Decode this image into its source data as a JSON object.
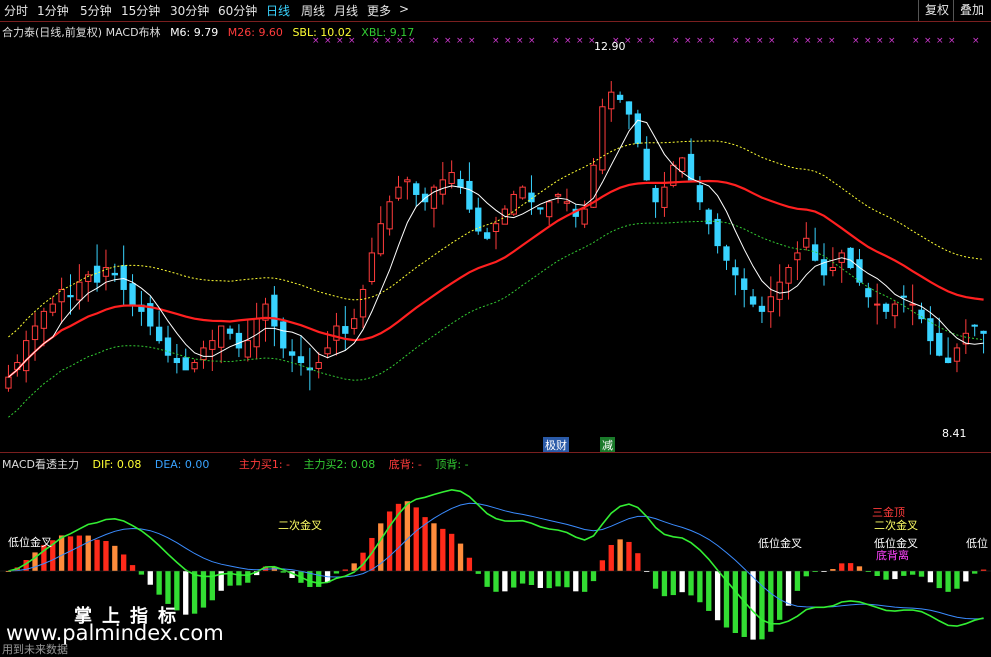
{
  "toolbar": {
    "periods": [
      "分时",
      "1分钟",
      "5分钟",
      "15分钟",
      "30分钟",
      "60分钟",
      "日线",
      "周线",
      "月线",
      "更多"
    ],
    "active": "日线",
    "more_arrow": ">",
    "right": [
      "复权",
      "叠加"
    ]
  },
  "main_indicator": {
    "title": "合力泰(日线,前复权) MACD布林",
    "m6": "M6: 9.79",
    "m26": "M26: 9.60",
    "sbl": "SBL: 10.02",
    "xbl": "XBL: 9.17"
  },
  "price_labels": {
    "high": "12.90",
    "low": "8.41"
  },
  "signals": {
    "s1": "极财",
    "s2": "减"
  },
  "sub_indicator": {
    "title": "MACD看透主力",
    "dif": "DIF: 0.08",
    "dea": "DEA: 0.00",
    "buy1": "主力买1: -",
    "buy2": "主力买2: 0.08",
    "bottom_div": "底背: -",
    "top_div": "顶背: -"
  },
  "sub_labels": {
    "a": "低位金叉",
    "b": "二次金叉",
    "c": "低位金叉",
    "d": "三金顶",
    "e": "二次金叉",
    "f": "低位金叉",
    "g": "底背离",
    "h": "低位"
  },
  "watermark": {
    "cn": "掌上指标",
    "url": "www.palmindex.com",
    "note": "用到未来数据"
  },
  "colors": {
    "up": "#ff3c3c",
    "down": "#39d3ff",
    "ma_red": "#ff2020",
    "ma_white": "#ffffff",
    "upper": "#ffff33",
    "lower": "#33cc33",
    "active_tab": "#39d3ff"
  },
  "chart_data": {
    "type": "candlestick",
    "ylim": [
      8.0,
      13.2
    ],
    "close": [
      8.6,
      8.8,
      9.1,
      9.3,
      9.5,
      9.6,
      9.8,
      9.7,
      9.9,
      10.0,
      9.9,
      10.1,
      10.0,
      9.8,
      9.6,
      9.5,
      9.3,
      9.1,
      8.9,
      8.8,
      8.7,
      8.8,
      9.0,
      9.1,
      9.3,
      9.2,
      9.0,
      9.1,
      9.4,
      9.6,
      9.3,
      9.0,
      8.9,
      8.8,
      8.7,
      8.8,
      9.0,
      9.3,
      9.2,
      9.4,
      9.8,
      10.3,
      10.7,
      11.0,
      11.2,
      11.3,
      11.1,
      11.0,
      11.2,
      11.3,
      11.4,
      11.2,
      10.9,
      10.6,
      10.5,
      10.7,
      10.9,
      11.1,
      11.2,
      11.0,
      10.9,
      11.0,
      11.1,
      11.0,
      10.8,
      10.9,
      11.5,
      12.3,
      12.5,
      12.4,
      12.2,
      11.8,
      11.3,
      11.0,
      11.2,
      11.5,
      11.6,
      11.3,
      11.0,
      10.7,
      10.4,
      10.2,
      10.0,
      9.8,
      9.6,
      9.5,
      9.7,
      9.9,
      10.1,
      10.3,
      10.5,
      10.2,
      10.0,
      10.1,
      10.3,
      10.1,
      9.9,
      9.7,
      9.6,
      9.5,
      9.6,
      9.7,
      9.6,
      9.4,
      9.1,
      8.9,
      8.8,
      9.0,
      9.2,
      9.3,
      9.2
    ],
    "ma_fast": "M6",
    "ma_slow": "M26",
    "sub_type": "macd_histogram"
  }
}
